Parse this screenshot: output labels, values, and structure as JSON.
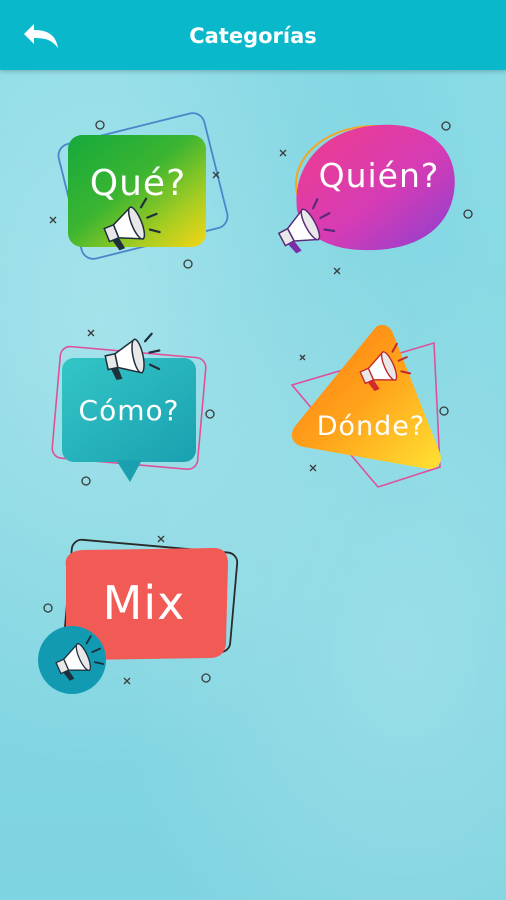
{
  "header": {
    "title": "Categorías",
    "back_icon": "back-arrow-icon"
  },
  "colors": {
    "app_bar": "#0ab8cc",
    "background": "#88dbe6",
    "que": "#3cb531",
    "quien": "#d63cb5",
    "como": "#22b2b8",
    "donde": "#ff9a1a",
    "mix": "#f25a55"
  },
  "categories": [
    {
      "label": "Qué?",
      "icon": "megaphone-icon"
    },
    {
      "label": "Quién?",
      "icon": "megaphone-icon"
    },
    {
      "label": "Cómo?",
      "icon": "megaphone-icon"
    },
    {
      "label": "Dónde?",
      "icon": "megaphone-icon"
    },
    {
      "label": "Mix",
      "icon": "megaphone-icon"
    }
  ]
}
